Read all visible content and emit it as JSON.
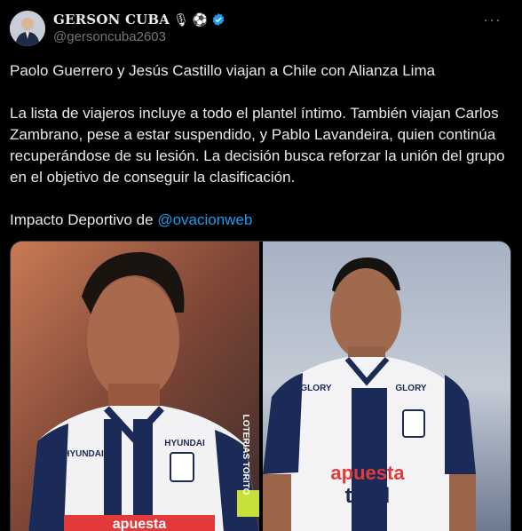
{
  "author": {
    "display_name": "GERSON CUBA",
    "handle": "@gersoncuba2603",
    "badge_emojis": [
      "🎙",
      "⚽"
    ],
    "verified_icon": "verified-badge-icon"
  },
  "more_label": "···",
  "tweet": {
    "headline": "Paolo Guerrero y Jesús Castillo viajan a Chile con Alianza Lima",
    "body": "La lista de viajeros incluye a todo el plantel íntimo. También viajan Carlos Zambrano, pese a estar suspendido, y Pablo Lavandeira, quien continúa recuperándose de su lesión. La decisión busca reforzar la unión del grupo en el objetivo de conseguir la clasificación.",
    "credit_prefix": "Impacto Deportivo de ",
    "credit_mention": "@ovacionweb"
  },
  "media": {
    "left_photo": {
      "sponsor_text": "HYUNDAI",
      "side_text": "LOTERIAS TORITO",
      "bottom_text": "apuesta"
    },
    "right_photo": {
      "sponsor_left": "GLORY",
      "sponsor_right": "GLORY",
      "shirt_line1": "apuesta",
      "shirt_line2": "total"
    }
  },
  "colors": {
    "background": "#000000",
    "text": "#e7e9ea",
    "muted": "#71767b",
    "accent": "#1d9bf0"
  }
}
